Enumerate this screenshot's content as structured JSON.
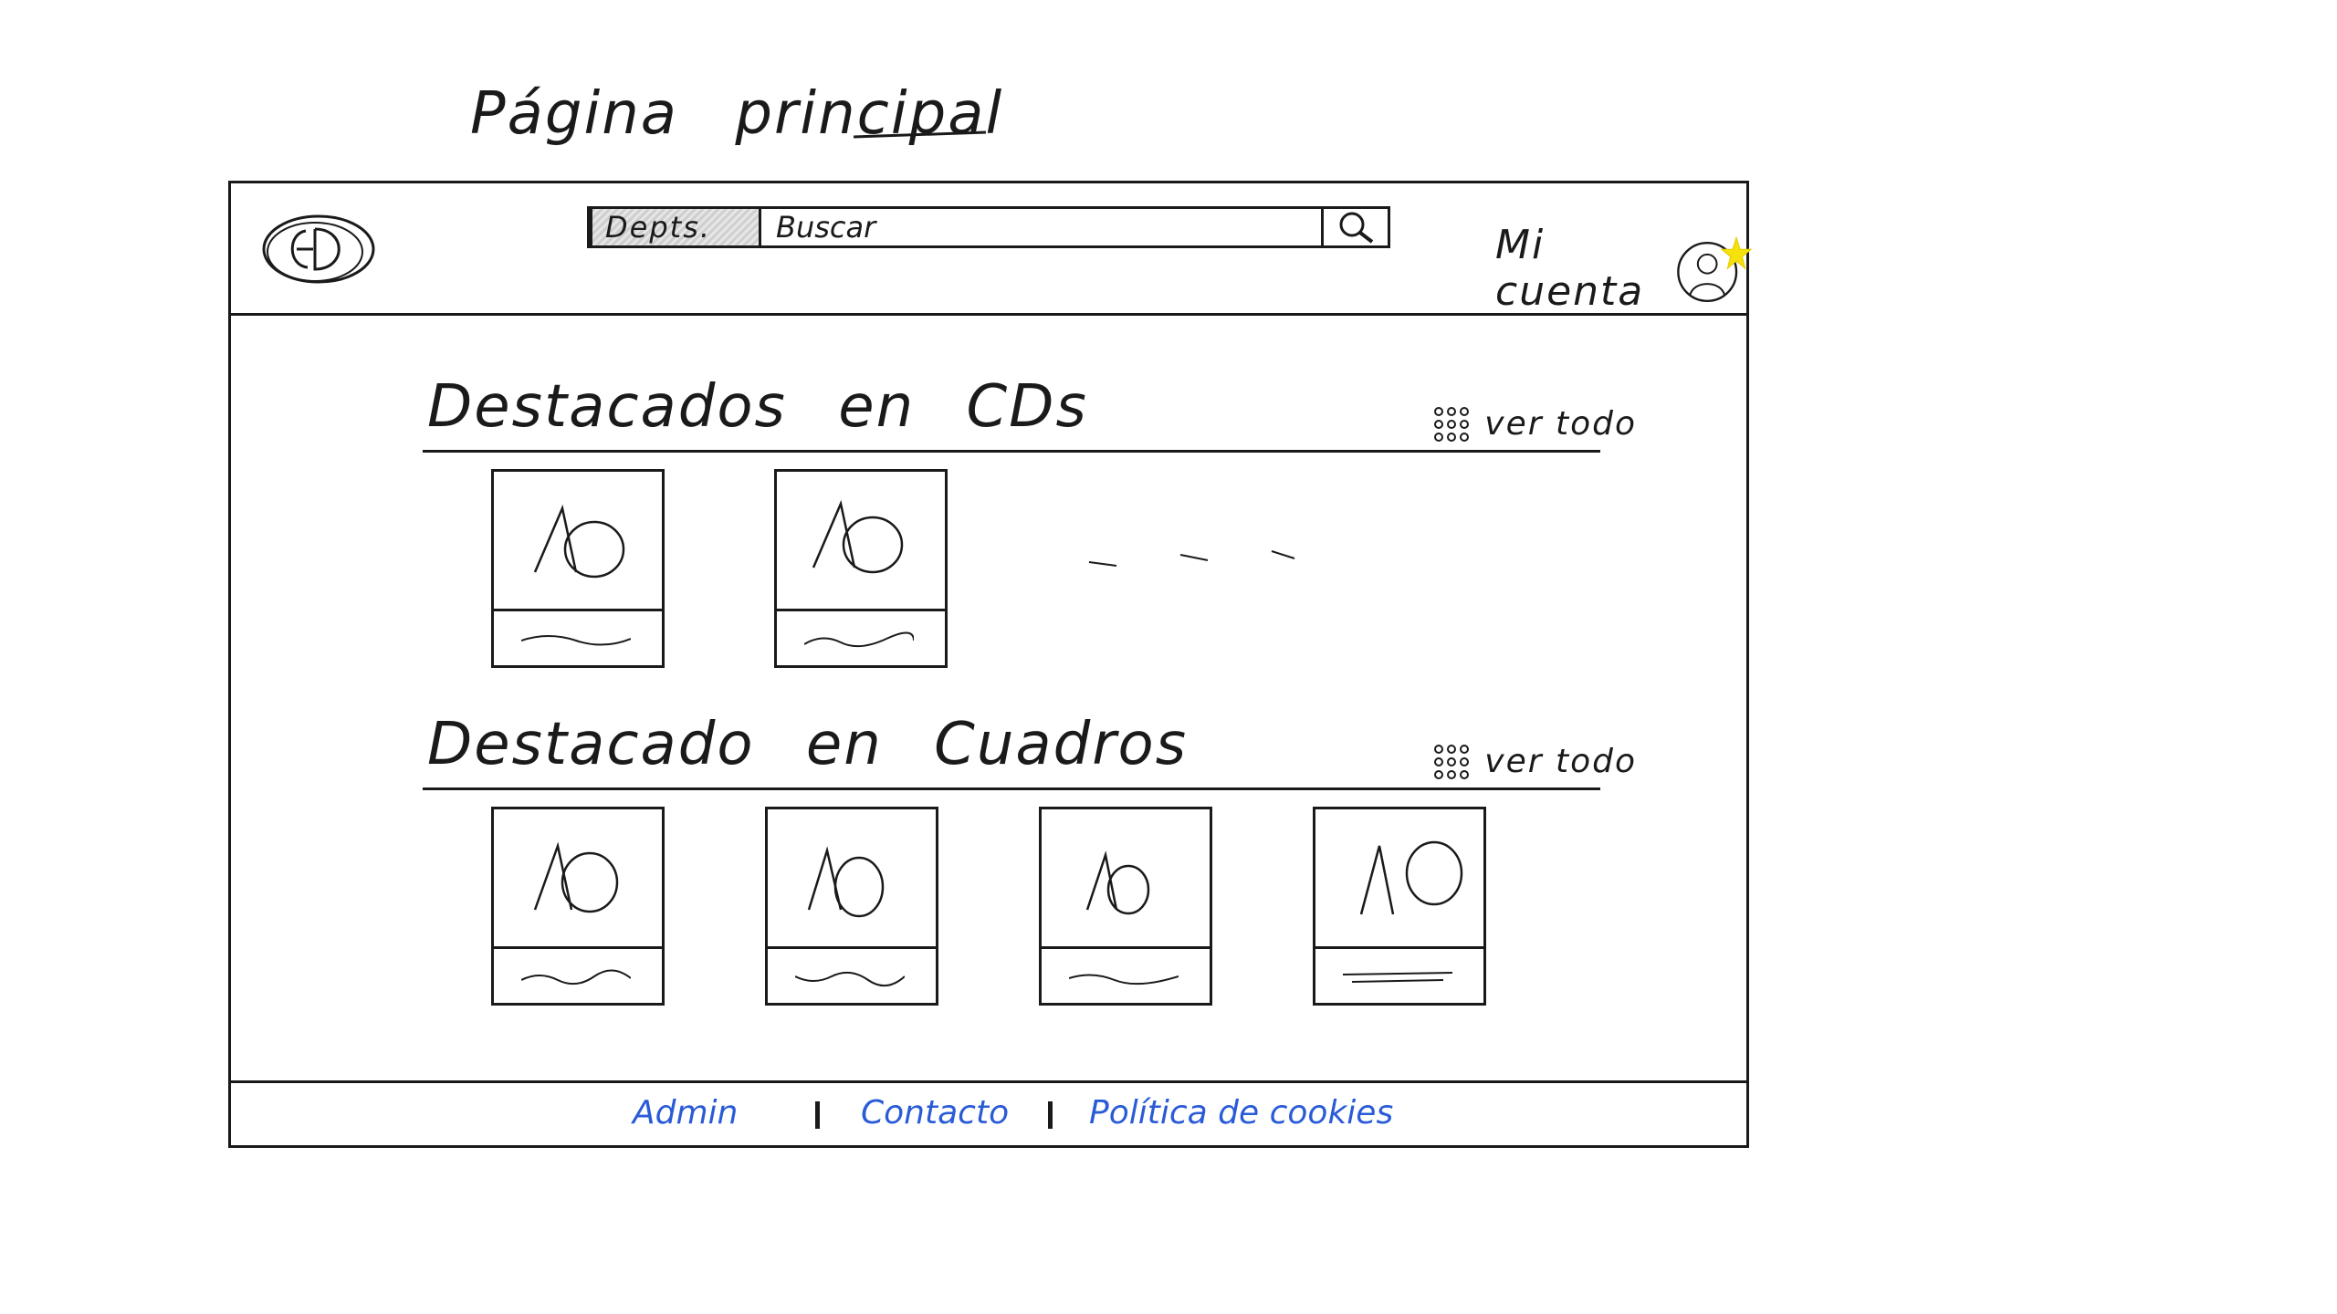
{
  "page": {
    "title": "Página principal"
  },
  "header": {
    "logo_icon": "cd-logo-icon",
    "search": {
      "department_label": "Depts.",
      "placeholder": "Buscar",
      "button_icon": "search-icon"
    },
    "account": {
      "label": "Mi cuenta",
      "avatar_icon": "user-avatar-icon",
      "badge_icon": "star-icon",
      "badge_color": "#f5e10c"
    }
  },
  "sections": [
    {
      "title": "Destacados en CDs",
      "view_all_label": "ver todo",
      "view_all_icon": "grid-icon",
      "items": 2
    },
    {
      "title": "Destacado en Cuadros",
      "view_all_label": "ver todo",
      "view_all_icon": "grid-icon",
      "items": 4
    }
  ],
  "footer": {
    "links": [
      "Admin",
      "Contacto",
      "Política de cookies"
    ],
    "link_color": "#2a5bd7"
  }
}
